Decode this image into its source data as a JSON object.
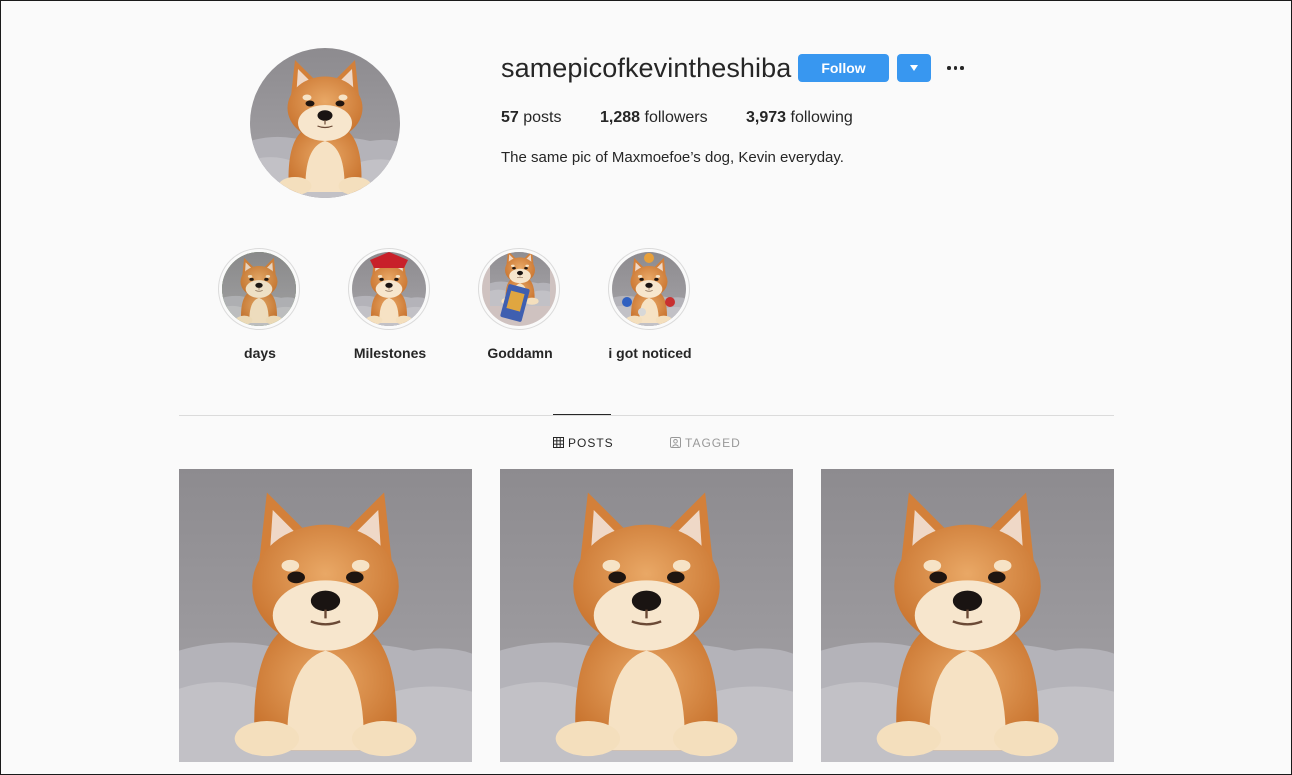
{
  "profile": {
    "username": "samepicofkevintheshiba",
    "follow_label": "Follow",
    "dropdown_icon": "caret-down-icon",
    "more_icon": "more-options-icon",
    "stats": {
      "posts_count": "57",
      "posts_label": "posts",
      "followers_count": "1,288",
      "followers_label": "followers",
      "following_count": "3,973",
      "following_label": "following"
    },
    "bio": "The same pic of Maxmoefoe’s dog, Kevin everyday."
  },
  "highlights": [
    {
      "label": "days"
    },
    {
      "label": "Milestones"
    },
    {
      "label": "Goddamn"
    },
    {
      "label": "i got noticed"
    }
  ],
  "tabs": [
    {
      "label": "POSTS",
      "icon": "grid-icon",
      "active": true
    },
    {
      "label": "TAGGED",
      "icon": "tagged-icon",
      "active": false
    }
  ],
  "colors": {
    "accent": "#3897f0",
    "background": "#fafafa",
    "text": "#262626",
    "muted": "#999999"
  }
}
